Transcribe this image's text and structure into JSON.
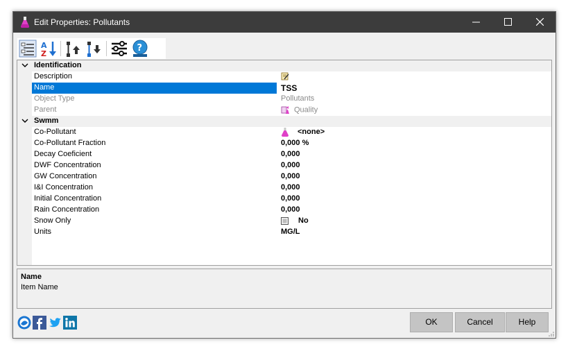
{
  "window": {
    "title": "Edit Properties: Pollutants"
  },
  "toolbar": {
    "buttons": [
      {
        "icon": "categorized-view-icon"
      },
      {
        "icon": "sort-az-icon"
      },
      {
        "icon": "move-up-icon"
      },
      {
        "icon": "move-down-icon"
      },
      {
        "icon": "settings-sliders-icon"
      },
      {
        "icon": "help-icon"
      }
    ]
  },
  "grid": {
    "categories": [
      {
        "label": "Identification",
        "rows": [
          {
            "name": "Description",
            "value": ""
          },
          {
            "name": "Name",
            "value": "TSS"
          },
          {
            "name": "Object Type",
            "value": "Pollutants"
          },
          {
            "name": "Parent",
            "value": "Quality"
          }
        ]
      },
      {
        "label": "Swmm",
        "rows": [
          {
            "name": "Co-Pollutant",
            "value": "<none>"
          },
          {
            "name": "Co-Pollutant Fraction",
            "value": "0,000 %"
          },
          {
            "name": "Decay Coeficient",
            "value": "0,000"
          },
          {
            "name": "DWF Concentration",
            "value": "0,000"
          },
          {
            "name": "GW Concentration",
            "value": "0,000"
          },
          {
            "name": "I&I Concentration",
            "value": "0,000"
          },
          {
            "name": "Initial Concentration",
            "value": "0,000"
          },
          {
            "name": "Rain Concentration",
            "value": "0,000"
          },
          {
            "name": "Snow Only",
            "value": "No"
          },
          {
            "name": "Units",
            "value": "MG/L"
          }
        ]
      }
    ]
  },
  "description": {
    "title": "Name",
    "text": "Item Name"
  },
  "buttons": {
    "ok": "OK",
    "cancel": "Cancel",
    "help": "Help"
  },
  "colors": {
    "titlebar": "#3c3c3c",
    "selection": "#0078d7",
    "button": "#c4c4c4"
  }
}
